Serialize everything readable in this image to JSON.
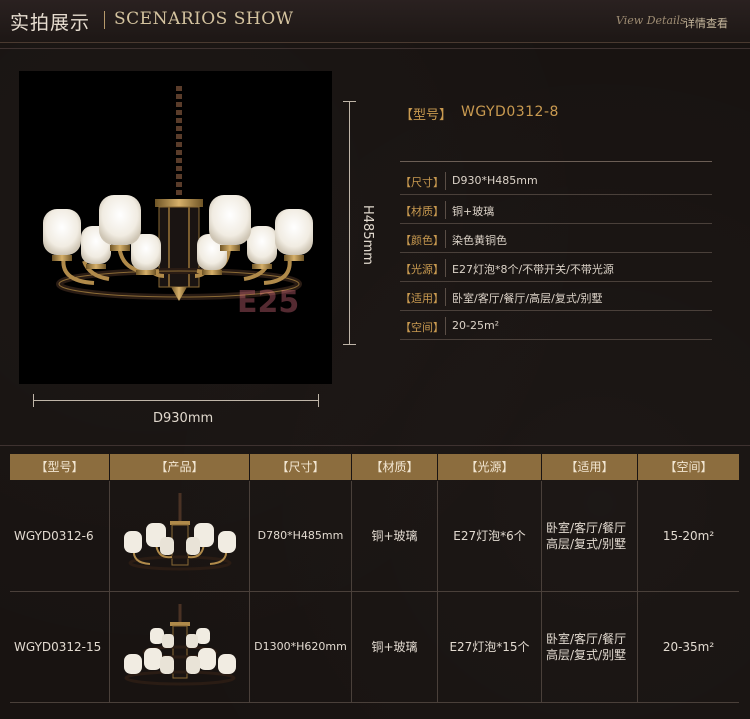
{
  "header": {
    "title_cn": "实拍展示",
    "title_en": "SCENARIOS SHOW",
    "script_text": "View Details",
    "more_label": "详情查看"
  },
  "product": {
    "image_name": "chandelier-photo",
    "watermark": "E25",
    "height_dim": "H485mm",
    "width_dim": "D930mm"
  },
  "specs": {
    "model_label": "【型号】",
    "model_value": "WGYD0312-8",
    "rows": [
      {
        "label": "【尺寸】",
        "value": "D930*H485mm"
      },
      {
        "label": "【材质】",
        "value": "铜+玻璃"
      },
      {
        "label": "【颜色】",
        "value": "染色黄铜色"
      },
      {
        "label": "【光源】",
        "value": "E27灯泡*8个/不带开关/不带光源"
      },
      {
        "label": "【适用】",
        "value": "卧室/客厅/餐厅/高层/复式/别墅"
      },
      {
        "label": "【空间】",
        "value": "20-25m²"
      }
    ]
  },
  "table": {
    "headers": [
      "【型号】",
      "【产品】",
      "【尺寸】",
      "【材质】",
      "【光源】",
      "【适用】",
      "【空间】"
    ],
    "rows": [
      {
        "model": "WGYD0312-6",
        "size": "D780*H485mm",
        "material": "铜+玻璃",
        "light": "E27灯泡*6个",
        "usage1": "卧室/客厅/餐厅",
        "usage2": "高层/复式/别墅",
        "space": "15-20m²"
      },
      {
        "model": "WGYD0312-15",
        "size": "D1300*H620mm",
        "material": "铜+玻璃",
        "light": "E27灯泡*15个",
        "usage1": "卧室/客厅/餐厅",
        "usage2": "高层/复式/别墅",
        "space": "20-35m²"
      }
    ]
  },
  "colors": {
    "accent_gold": "#c99a50",
    "header_bar": "#8c6d3e",
    "background": "#181311"
  }
}
